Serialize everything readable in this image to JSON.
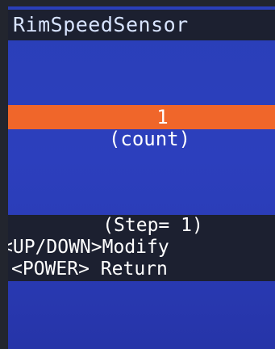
{
  "header": {
    "title": "RimSpeedSensor"
  },
  "value_field": {
    "value": "1",
    "unit": "(count)"
  },
  "help": {
    "step": "(Step=   1)",
    "modify": "<UP/DOWN>Modify",
    "return": "<POWER> Return"
  },
  "colors": {
    "screen_background": "#2c3fbd",
    "highlight_bar": "#f0662a",
    "dark_panel": "#1c2030",
    "text": "#ffffff"
  }
}
